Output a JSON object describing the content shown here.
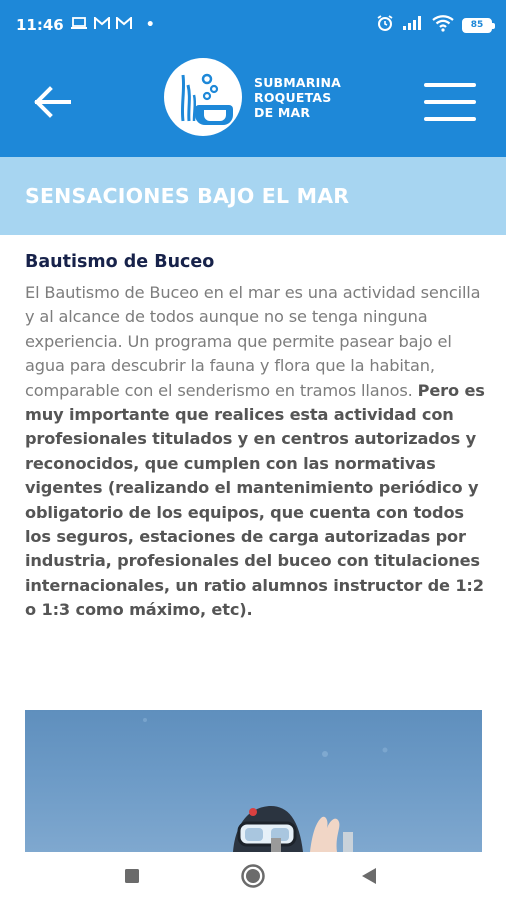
{
  "status_bar": {
    "time": "11:46",
    "notif_icons": [
      "laptop-icon",
      "gmail-icon",
      "gmail-icon"
    ],
    "battery_level": "85"
  },
  "header": {
    "logo_lines": [
      "SUBMARINA",
      "ROQUETAS",
      "DE MAR"
    ],
    "back_icon": "arrow-left-icon",
    "menu_icon": "hamburger-menu-icon"
  },
  "banner": {
    "title": "SENSACIONES BAJO EL MAR"
  },
  "article": {
    "heading": "Bautismo de Buceo",
    "paragraph_normal": "El Bautismo de Buceo en el mar es una actividad sencilla y al alcance de todos aunque no se tenga ninguna experiencia. Un programa que permite pasear bajo el agua para descubrir la fauna y flora que la habitan, comparable con el senderismo en tramos llanos.",
    "paragraph_bold": "Pero es muy importante que realices esta actividad con profesionales titulados y en centros autorizados y reconocidos, que cumplen con las normativas vigentes (realizando el mantenimiento periódico y obligatorio de los equipos, que cuenta con todos los seguros, estaciones de carga autorizadas por industria, profesionales del buceo con titulaciones internacionales, un ratio alumnos instructor de 1:2 o 1:3 como máximo, etc)."
  },
  "colors": {
    "primary": "#1e88d8",
    "banner": "#a7d5f1",
    "heading": "#17224a"
  }
}
